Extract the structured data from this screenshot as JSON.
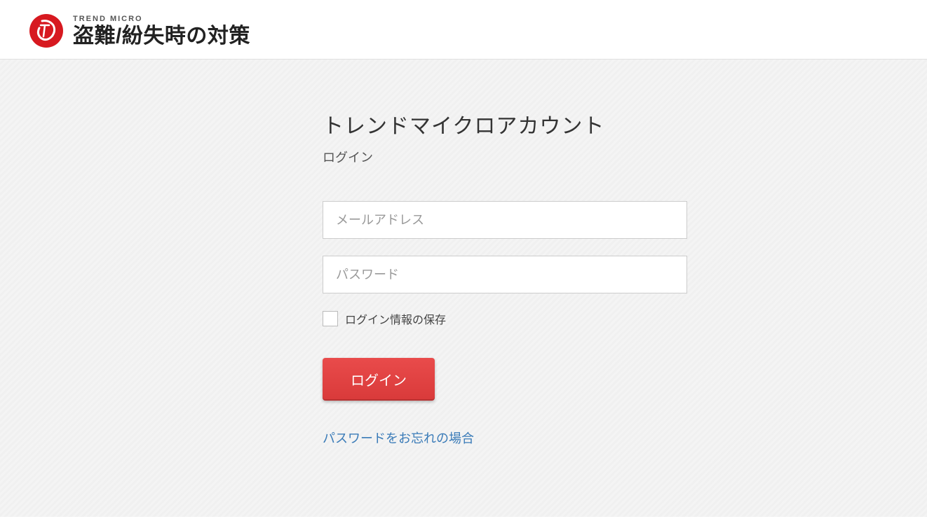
{
  "header": {
    "brand_small": "TREND MICRO",
    "app_title": "盗難/紛失時の対策"
  },
  "login": {
    "heading": "トレンドマイクロアカウント",
    "subheading": "ログイン",
    "email_placeholder": "メールアドレス",
    "password_placeholder": "パスワード",
    "remember_label": "ログイン情報の保存",
    "submit_label": "ログイン",
    "forgot_label": "パスワードをお忘れの場合"
  },
  "colors": {
    "accent": "#d93a3a",
    "link": "#3a7bb8"
  }
}
